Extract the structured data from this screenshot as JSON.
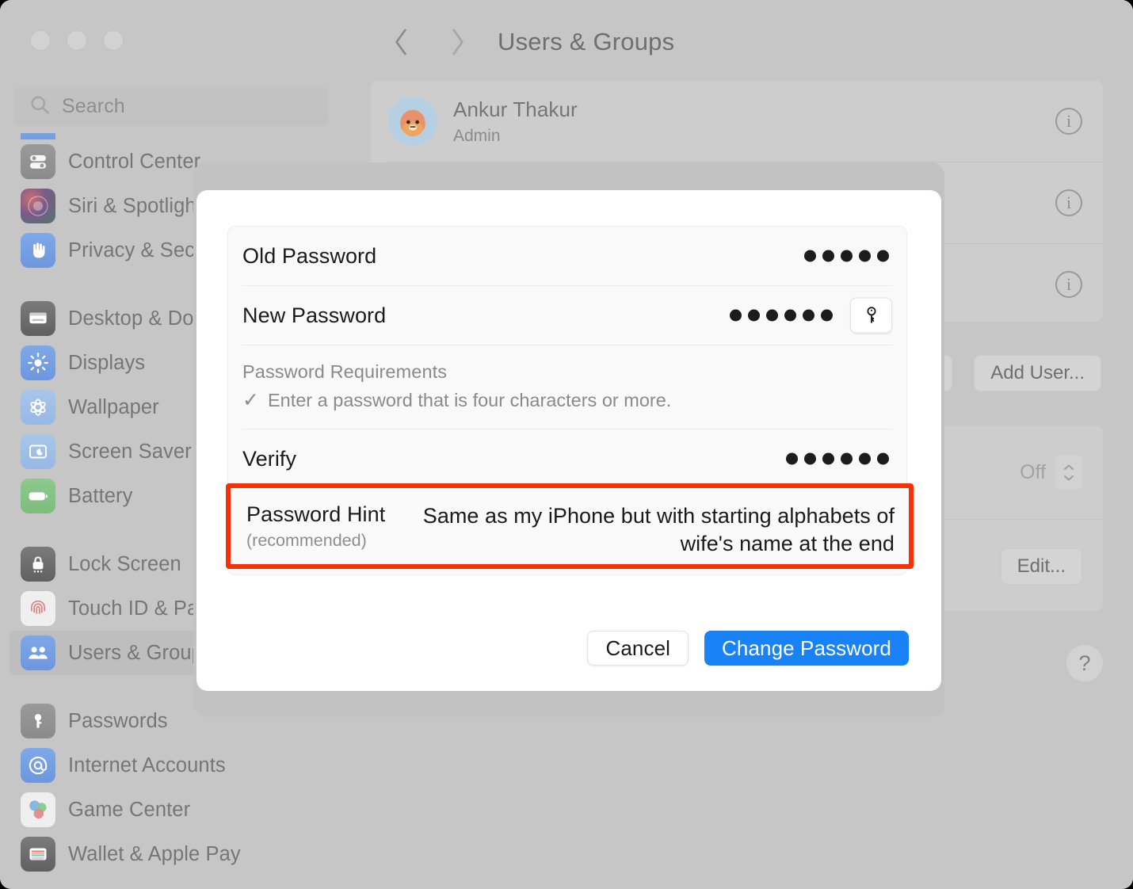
{
  "window": {
    "traffic_lights": [
      "close",
      "minimize",
      "zoom"
    ]
  },
  "search": {
    "placeholder": "Search",
    "icon": "search-icon"
  },
  "sidebar": {
    "groups": [
      {
        "items": [
          {
            "label": "Control Center",
            "icon": "control-center-icon",
            "selected": false
          },
          {
            "label": "Siri & Spotlight",
            "icon": "siri-spotlight-icon",
            "selected": false
          },
          {
            "label": "Privacy & Security",
            "icon": "privacy-security-icon",
            "selected": false
          }
        ]
      },
      {
        "items": [
          {
            "label": "Desktop & Dock",
            "icon": "desktop-dock-icon",
            "selected": false
          },
          {
            "label": "Displays",
            "icon": "displays-icon",
            "selected": false
          },
          {
            "label": "Wallpaper",
            "icon": "wallpaper-icon",
            "selected": false
          },
          {
            "label": "Screen Saver",
            "icon": "screen-saver-icon",
            "selected": false
          },
          {
            "label": "Battery",
            "icon": "battery-icon",
            "selected": false
          }
        ]
      },
      {
        "items": [
          {
            "label": "Lock Screen",
            "icon": "lock-screen-icon",
            "selected": false
          },
          {
            "label": "Touch ID & Password",
            "icon": "touch-id-icon",
            "selected": false
          },
          {
            "label": "Users & Groups",
            "icon": "users-groups-icon",
            "selected": true
          }
        ]
      },
      {
        "items": [
          {
            "label": "Passwords",
            "icon": "passwords-icon",
            "selected": false
          },
          {
            "label": "Internet Accounts",
            "icon": "internet-accounts-icon",
            "selected": false
          },
          {
            "label": "Game Center",
            "icon": "game-center-icon",
            "selected": false
          },
          {
            "label": "Wallet & Apple Pay",
            "icon": "wallet-apple-pay-icon",
            "selected": false
          }
        ]
      }
    ]
  },
  "detail": {
    "nav": {
      "back": "back-chevron",
      "forward": "forward-chevron"
    },
    "title": "Users & Groups",
    "users": [
      {
        "name": "Ankur Thakur",
        "role": "Admin",
        "info": "i"
      },
      {
        "name": "",
        "role": "",
        "info": "i"
      },
      {
        "name": "",
        "role": "",
        "info": "i"
      }
    ],
    "buttons": {
      "groups_label": "...",
      "add_user_label": "Add User...",
      "edit_label": "Edit...",
      "help_label": "?"
    },
    "options": [
      {
        "label": "",
        "value": "Off"
      }
    ]
  },
  "sheet": {
    "fields": [
      {
        "name": "old_password",
        "label": "Old Password",
        "dots": 5,
        "has_key_button": false
      },
      {
        "name": "new_password",
        "label": "New Password",
        "dots": 6,
        "has_key_button": true
      }
    ],
    "requirements": {
      "title": "Password Requirements",
      "check_glyph": "✓",
      "items": [
        "Enter a password that is four characters or more."
      ]
    },
    "verify": {
      "label": "Verify",
      "dots": 6
    },
    "hint": {
      "label": "Password Hint",
      "sublabel": "(recommended)",
      "value": "Same as my iPhone but with starting alphabets of wife's name at the end",
      "highlight_color": "#f83005"
    },
    "buttons": {
      "cancel_label": "Cancel",
      "submit_label": "Change Password",
      "submit_color": "#1a82f7"
    }
  }
}
